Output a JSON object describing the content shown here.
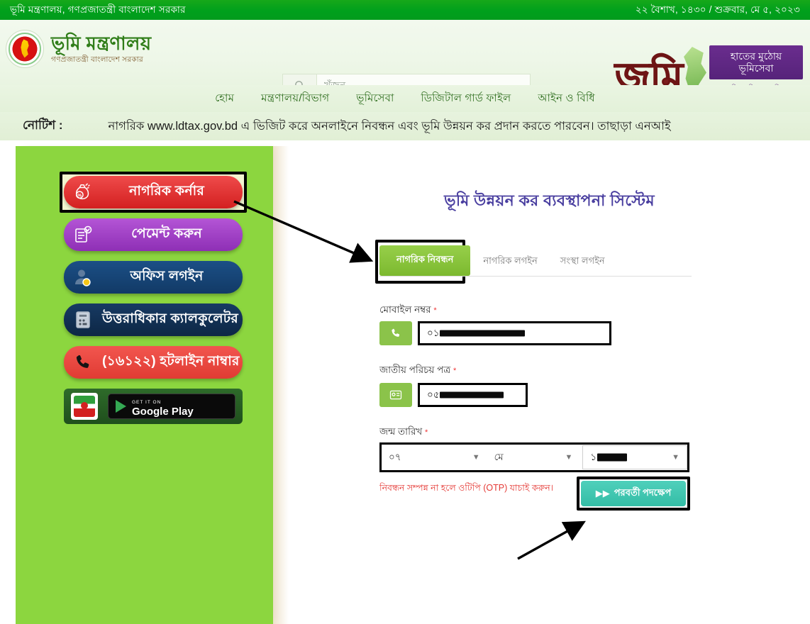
{
  "topbar": {
    "ministry": "ভূমি মন্ত্রণালয়, গণপ্রজাতন্ত্রী বাংলাদেশ সরকার",
    "date": "২২ বৈশাখ, ১৪৩০ / শুক্রবার, মে ৫, ২০২৩"
  },
  "header": {
    "brand_title": "ভূমি মন্ত্রণালয়",
    "brand_sub": "গণপ্রজাতন্ত্রী বাংলাদেশ সরকার",
    "search_placeholder": "খুঁজুন",
    "jomi_word": "জমি",
    "jomi_badge_line1": "হাতের মুঠোয়",
    "jomi_badge_line2": "ভূমিসেবা",
    "jomi_slogan": "এসো নিজে নিজের ভূমি-কাজ করি"
  },
  "nav": {
    "items": [
      {
        "label": "হোম"
      },
      {
        "label": "মন্ত্রণালয়/বিভাগ"
      },
      {
        "label": "ভূমিসেবা"
      },
      {
        "label": "ডিজিটাল গার্ড ফাইল"
      },
      {
        "label": "আইন ও বিধি"
      }
    ]
  },
  "notice": {
    "label": "নোটিশ :",
    "text": "নাগরিক www.ldtax.gov.bd এ ভিজিট করে অনলাইনে নিবন্ধন এবং ভূমি উন্নয়ন কর প্রদান করতে পারবেন। তাছাড়া এনআই"
  },
  "sidebar": {
    "buttons": [
      {
        "label": "নাগরিক কর্নার",
        "icon": "money-bag-icon",
        "color": "#d32020",
        "highlighted": true
      },
      {
        "label": "পেমেন্ট করুন",
        "icon": "invoice-check-icon",
        "color": "#8e2fb5",
        "highlighted": false
      },
      {
        "label": "অফিস লগইন",
        "icon": "user-badge-icon",
        "color": "#123a66",
        "highlighted": false
      },
      {
        "label": "উত্তরাধিকার ক্যালকুলেটর",
        "icon": "calculator-icon",
        "color": "#0d2745",
        "highlighted": false
      },
      {
        "label": "(১৬১২২) হটলাইন নাম্বার",
        "icon": "phone-icon",
        "color": "#e03b33",
        "highlighted": false
      }
    ],
    "play": {
      "small_label": "GET IT ON",
      "big_label": "Google Play",
      "app_icon": "ldtax-app-icon"
    }
  },
  "main": {
    "title": "ভূমি উন্নয়ন কর ব্যবস্থাপনা সিস্টেম",
    "tabs": [
      {
        "label": "নাগরিক নিবন্ধন",
        "active": true,
        "highlighted": true
      },
      {
        "label": "নাগরিক লগইন",
        "active": false,
        "highlighted": false
      },
      {
        "label": "সংস্থা লগইন",
        "active": false,
        "highlighted": false
      }
    ],
    "fields": {
      "mobile": {
        "label": "মোবাইল নম্বর",
        "required_mark": "*",
        "icon": "phone-icon",
        "value_prefix": "০১",
        "redacted": true
      },
      "nid": {
        "label": "জাতীয় পরিচয় পত্র",
        "required_mark": "*",
        "icon": "id-card-icon",
        "value_prefix": "০৫",
        "redacted": true
      },
      "dob": {
        "label": "জন্ম তারিখ",
        "required_mark": "*",
        "day": "০৭",
        "month": "মে",
        "year_prefix": "১",
        "year_redacted": true
      }
    },
    "hint": "নিবন্ধন সম্পন্ন না হলে ওটিপি (OTP) যাচাই করুন।",
    "next_button": "পরবর্তী পদক্ষেপ"
  },
  "colors": {
    "top_green": "#00a01c",
    "panel_green": "#8cd63f",
    "title_purple": "#4a3fa0",
    "tab_active_green": "#7cb92f",
    "next_teal": "#34bda6",
    "hint_red": "#e53935"
  }
}
